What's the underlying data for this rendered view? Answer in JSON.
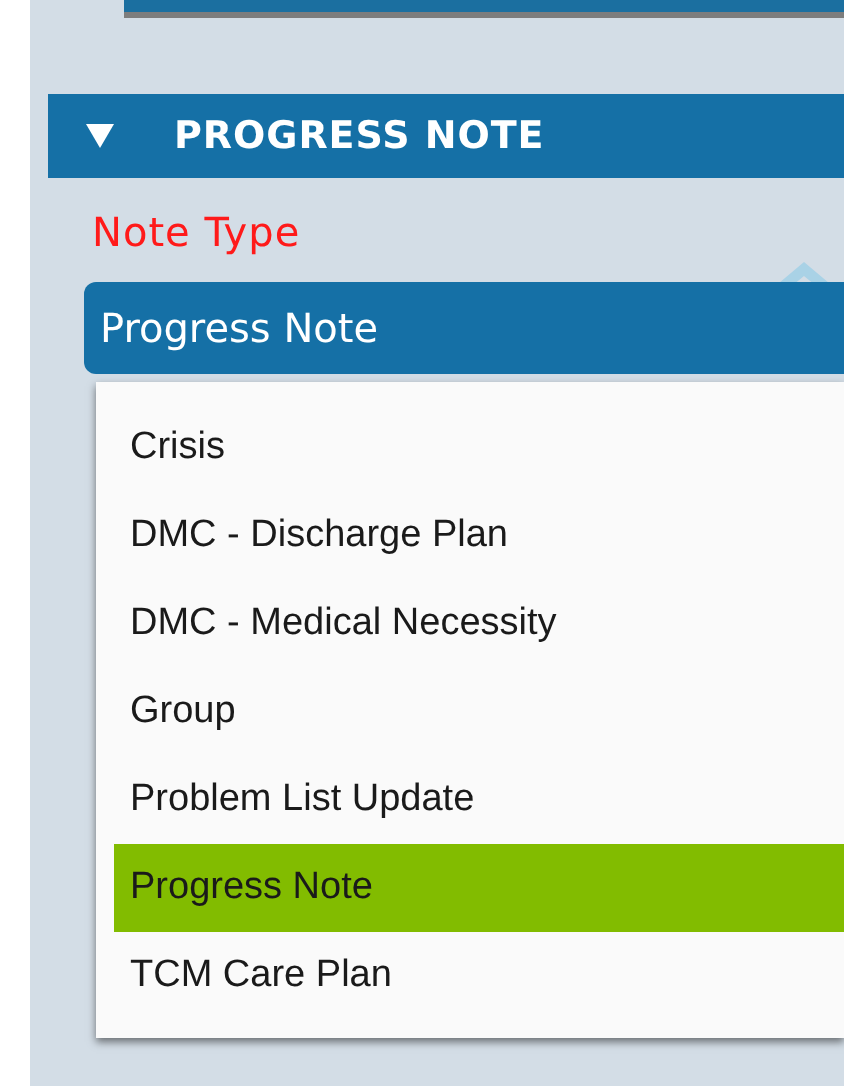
{
  "section": {
    "title": "PROGRESS NOTE",
    "expanded": true
  },
  "field": {
    "label": "Note Type",
    "value": "Progress Note"
  },
  "dropdown": {
    "options": [
      {
        "label": "Crisis",
        "selected": false
      },
      {
        "label": "DMC - Discharge Plan",
        "selected": false
      },
      {
        "label": "DMC - Medical Necessity",
        "selected": false
      },
      {
        "label": "Group",
        "selected": false
      },
      {
        "label": "Problem List Update",
        "selected": false
      },
      {
        "label": "Progress Note",
        "selected": true
      },
      {
        "label": "TCM Care Plan",
        "selected": false
      }
    ]
  }
}
